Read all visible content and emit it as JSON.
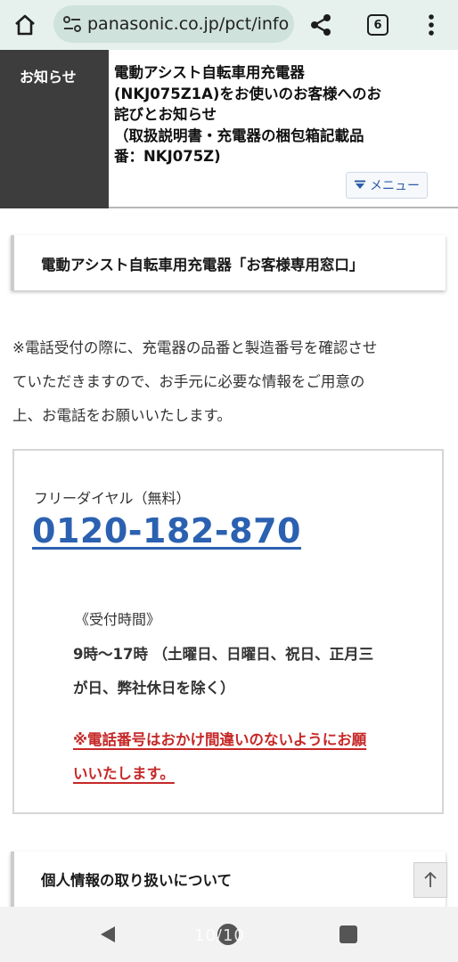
{
  "browser": {
    "url": "panasonic.co.jp/pct/info",
    "tab_count": "6"
  },
  "notice": {
    "label": "お知らせ",
    "lines": [
      "電動アシスト自転車用充電器",
      "(NKJ075Z1A)をお使いのお客様へのお",
      "詫びとお知らせ",
      "（取扱説明書・充電器の梱包箱記載品",
      "番：NKJ075Z)"
    ],
    "menu_label": "メニュー"
  },
  "main": {
    "heading": "電動アシスト自転車用充電器「お客様専用窓口」",
    "intro_lines": [
      "※電話受付の際に、充電器の品番と製造番号を確認させ",
      "ていただきますので、お手元に必要な情報をご用意の",
      "上、お電話をお願いいたします。"
    ],
    "free_dial_label": "フリーダイヤル（無料）",
    "phone": "0120-182-870",
    "hours_label": "《受付時間》",
    "hours_lines": [
      "9時〜17時 （土曜日、日曜日、祝日、正月三",
      "が日、弊社休日を除く）"
    ],
    "warning_lines": [
      "※電話番号はおかけ間違いのないようにお願",
      "いいたします。"
    ],
    "heading_2": "個人情報の取り扱いについて"
  },
  "nav": {
    "page_counter": "10/10"
  },
  "colors": {
    "phone": "#2b61b0",
    "warning": "#c62828",
    "notice_label_bg": "#3d3d3d",
    "browser_bar": "#e6f1ee"
  },
  "icons": [
    "home-icon",
    "site-settings-icon",
    "share-icon",
    "tabs-icon",
    "more-vert-icon",
    "menu-expand-icon",
    "arrow-up-icon",
    "nav-back-icon",
    "nav-home-icon",
    "nav-recent-icon"
  ]
}
